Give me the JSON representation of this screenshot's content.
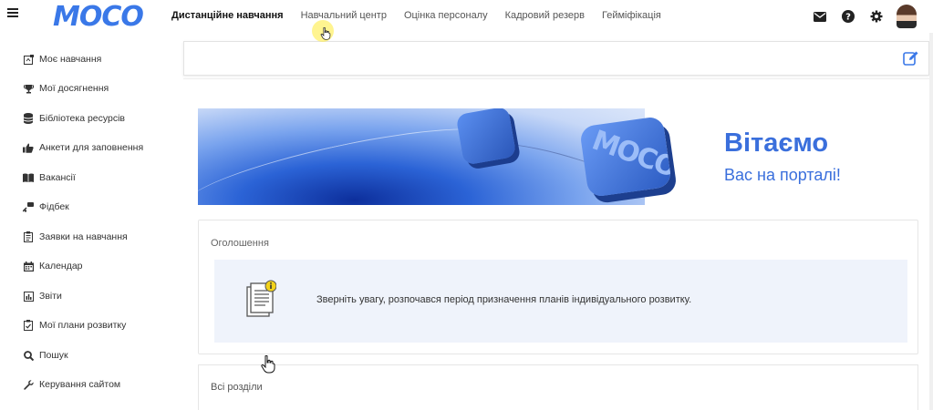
{
  "app": {
    "logo": "MOCO"
  },
  "topnav": [
    {
      "label": "Дистанційне навчання",
      "active": true
    },
    {
      "label": "Навчальний центр",
      "active": false
    },
    {
      "label": "Оцінка персоналу",
      "active": false
    },
    {
      "label": "Кадровий резерв",
      "active": false
    },
    {
      "label": "Гейміфікація",
      "active": false
    }
  ],
  "top_icons": [
    "envelope-icon",
    "help-icon",
    "gear-icon",
    "user-avatar"
  ],
  "sidebar": {
    "items": [
      {
        "label": "Моє навчання",
        "icon": "learning-icon"
      },
      {
        "label": "Мої досягнення",
        "icon": "trophy-icon"
      },
      {
        "label": "Бібліотека ресурсів",
        "icon": "database-icon"
      },
      {
        "label": "Анкети для заповнення",
        "icon": "thumbs-up-icon"
      },
      {
        "label": "Вакансії",
        "icon": "book-icon"
      },
      {
        "label": "Фідбек",
        "icon": "feedback-icon"
      },
      {
        "label": "Заявки на навчання",
        "icon": "request-icon"
      },
      {
        "label": "Календар",
        "icon": "calendar-icon"
      },
      {
        "label": "Звіти",
        "icon": "reports-icon"
      },
      {
        "label": "Мої плани розвитку",
        "icon": "plan-icon"
      },
      {
        "label": "Пошук",
        "icon": "search-icon"
      },
      {
        "label": "Керування сайтом",
        "icon": "wrench-icon"
      }
    ]
  },
  "banner": {
    "title": "Вітаємо",
    "subtitle": "Вас на порталі!",
    "cube_text": "MOCO"
  },
  "announcements": {
    "title": "Оголошення",
    "text": "Зверніть увагу, розпочався період призначення планів індивідуального розвитку."
  },
  "sections": {
    "title": "Всі розділи"
  },
  "colors": {
    "brand": "#3a78e8",
    "welcome": "#3a6fdc",
    "card_bg": "#eff3fb"
  }
}
